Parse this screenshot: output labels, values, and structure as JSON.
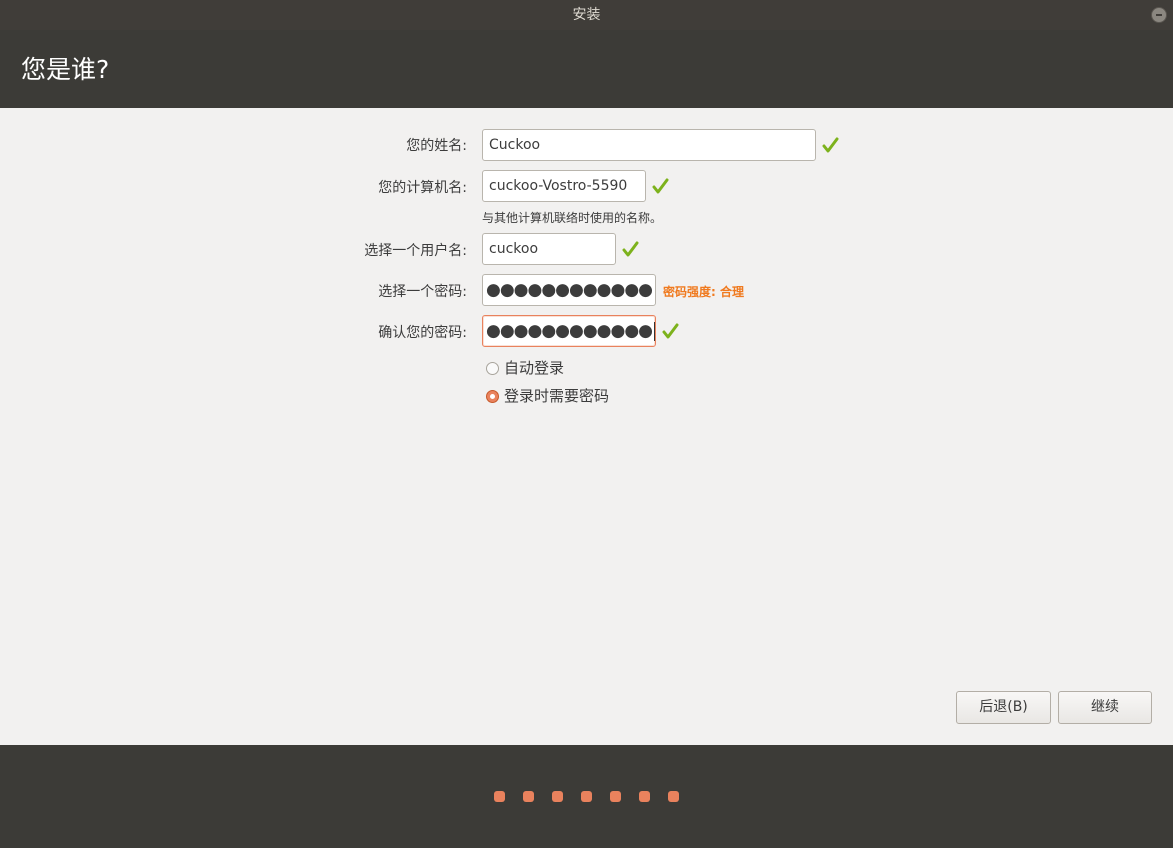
{
  "window": {
    "title": "安装"
  },
  "header": {
    "title": "您是谁?"
  },
  "form": {
    "name_label": "您的姓名:",
    "name_value": "Cuckoo",
    "computer_label": "您的计算机名:",
    "computer_value": "cuckoo-Vostro-5590",
    "computer_hint": "与其他计算机联络时使用的名称。",
    "username_label": "选择一个用户名:",
    "username_value": "cuckoo",
    "password_label": "选择一个密码:",
    "password_mask": "●●●●●●●●●●●●",
    "password_strength": "密码强度: 合理",
    "confirm_label": "确认您的密码:",
    "confirm_mask": "●●●●●●●●●●●●"
  },
  "login_options": {
    "auto_login": "自动登录",
    "require_password": "登录时需要密码",
    "selected": "require_password"
  },
  "buttons": {
    "back": "后退(B)",
    "continue": "继续"
  },
  "progress": {
    "total_steps": 7
  },
  "colors": {
    "accent": "#e9825d",
    "check": "#7db21c",
    "strength": "#f07a1f",
    "header_bg": "#3c3b37"
  }
}
